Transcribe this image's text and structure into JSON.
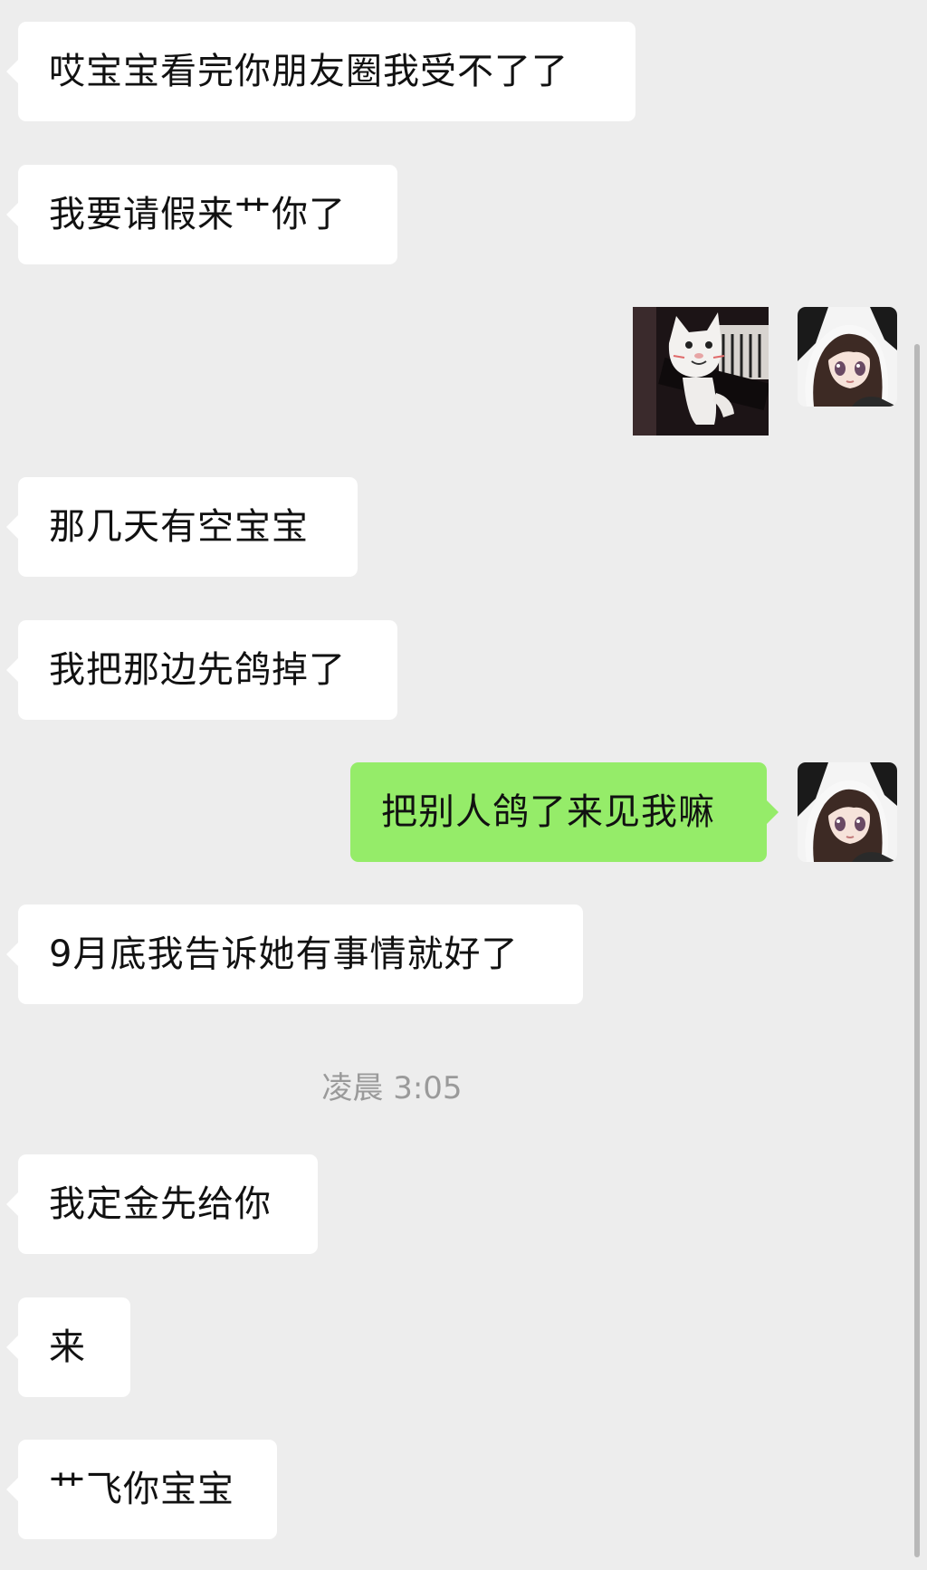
{
  "messages": {
    "m1": "哎宝宝看完你朋友圈我受不了了",
    "m2": "我要请假来艹你了",
    "m4": "那几天有空宝宝",
    "m5": "我把那边先鸽掉了",
    "m6": "把别人鸽了来见我嘛",
    "m7": "9月底我告诉她有事情就好了",
    "m8": "我定金先给你",
    "m9": "来",
    "m10": "艹飞你宝宝"
  },
  "timestamp": "凌晨 3:05",
  "sticker": {
    "icon": "cat-sticker-icon"
  },
  "avatar": {
    "icon": "anime-girl-avatar-icon"
  },
  "colors": {
    "background": "#ededed",
    "incoming_bubble": "#ffffff",
    "outgoing_bubble": "#95ec69",
    "timestamp_text": "#9a9a9a"
  }
}
